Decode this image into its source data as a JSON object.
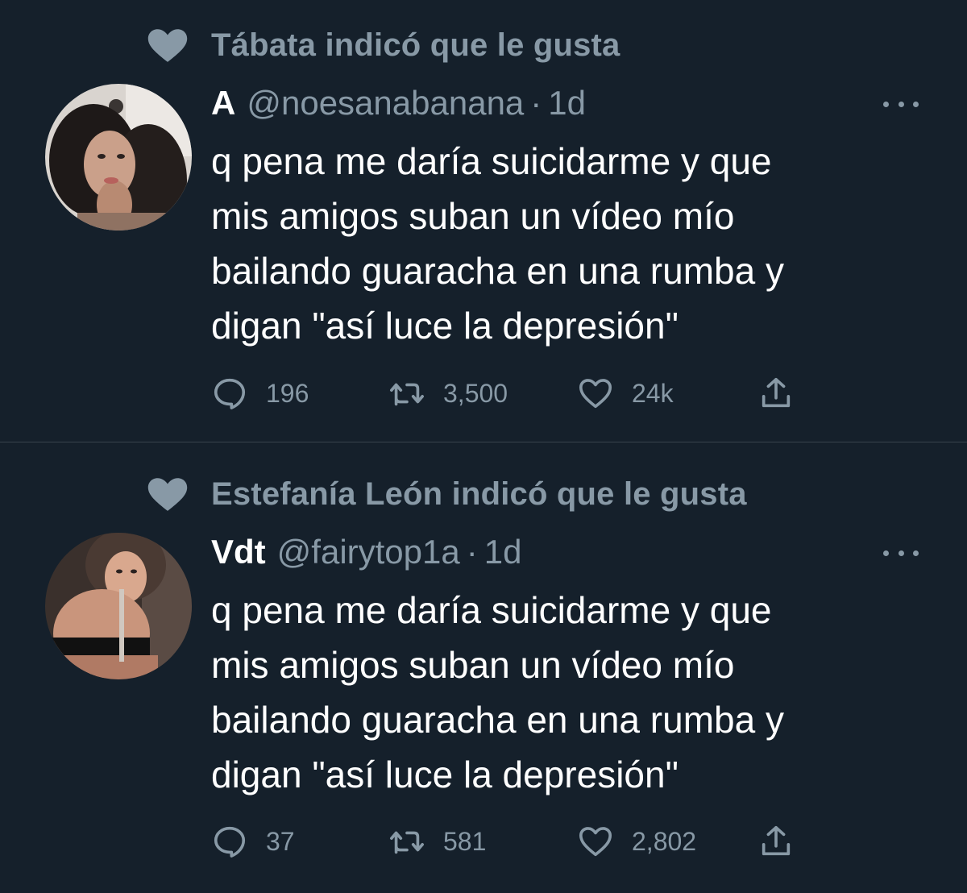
{
  "colors": {
    "background": "#15202b",
    "secondary_text": "#8899a6",
    "primary_text": "#ffffff",
    "divider": "#38444d"
  },
  "tweets": [
    {
      "social_context": "Tábata indicó que le gusta",
      "display_name": "A",
      "handle": "@noesanabanana",
      "separator": "·",
      "time": "1d",
      "text": "q pena me daría suicidarme y que\nmis amigos suban un vídeo mío\nbailando guaracha en una rumba y\ndigan \"así luce la depresión\"",
      "replies": "196",
      "retweets": "3,500",
      "likes": "24k"
    },
    {
      "social_context": "Estefanía León indicó que le gusta",
      "display_name": "Vdt",
      "handle": "@fairytop1a",
      "separator": "·",
      "time": "1d",
      "text": "q pena me daría suicidarme y que\nmis amigos suban un vídeo mío\nbailando guaracha en una rumba y\ndigan \"así luce la depresión\"",
      "replies": "37",
      "retweets": "581",
      "likes": "2,802"
    }
  ],
  "icons": {
    "social_context": "heart-filled-icon",
    "more": "more-horizontal-icon",
    "reply": "reply-bubble-icon",
    "retweet": "retweet-icon",
    "like": "heart-outline-icon",
    "share": "share-upload-icon"
  }
}
